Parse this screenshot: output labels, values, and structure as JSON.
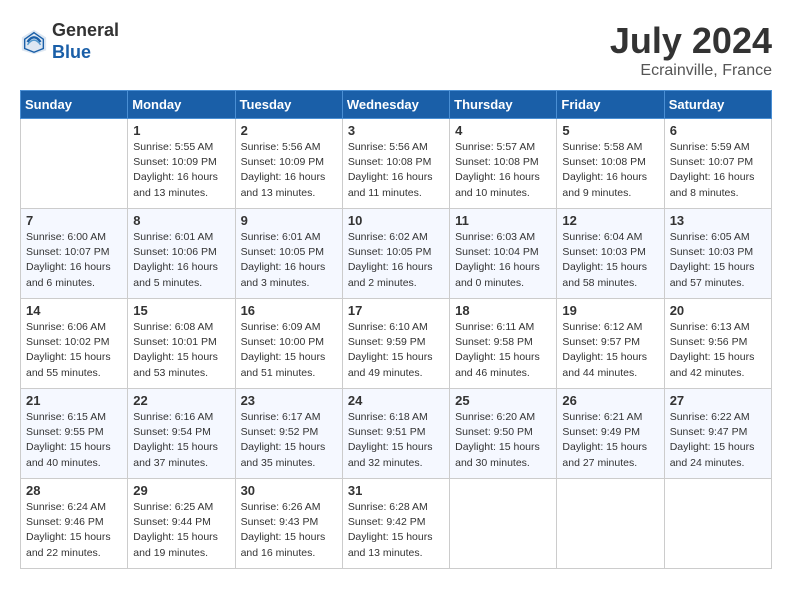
{
  "header": {
    "logo_line1": "General",
    "logo_line2": "Blue",
    "title": "July 2024",
    "location": "Ecrainville, France"
  },
  "columns": [
    "Sunday",
    "Monday",
    "Tuesday",
    "Wednesday",
    "Thursday",
    "Friday",
    "Saturday"
  ],
  "weeks": [
    [
      {
        "day": "",
        "info": ""
      },
      {
        "day": "1",
        "info": "Sunrise: 5:55 AM\nSunset: 10:09 PM\nDaylight: 16 hours\nand 13 minutes."
      },
      {
        "day": "2",
        "info": "Sunrise: 5:56 AM\nSunset: 10:09 PM\nDaylight: 16 hours\nand 13 minutes."
      },
      {
        "day": "3",
        "info": "Sunrise: 5:56 AM\nSunset: 10:08 PM\nDaylight: 16 hours\nand 11 minutes."
      },
      {
        "day": "4",
        "info": "Sunrise: 5:57 AM\nSunset: 10:08 PM\nDaylight: 16 hours\nand 10 minutes."
      },
      {
        "day": "5",
        "info": "Sunrise: 5:58 AM\nSunset: 10:08 PM\nDaylight: 16 hours\nand 9 minutes."
      },
      {
        "day": "6",
        "info": "Sunrise: 5:59 AM\nSunset: 10:07 PM\nDaylight: 16 hours\nand 8 minutes."
      }
    ],
    [
      {
        "day": "7",
        "info": "Sunrise: 6:00 AM\nSunset: 10:07 PM\nDaylight: 16 hours\nand 6 minutes."
      },
      {
        "day": "8",
        "info": "Sunrise: 6:01 AM\nSunset: 10:06 PM\nDaylight: 16 hours\nand 5 minutes."
      },
      {
        "day": "9",
        "info": "Sunrise: 6:01 AM\nSunset: 10:05 PM\nDaylight: 16 hours\nand 3 minutes."
      },
      {
        "day": "10",
        "info": "Sunrise: 6:02 AM\nSunset: 10:05 PM\nDaylight: 16 hours\nand 2 minutes."
      },
      {
        "day": "11",
        "info": "Sunrise: 6:03 AM\nSunset: 10:04 PM\nDaylight: 16 hours\nand 0 minutes."
      },
      {
        "day": "12",
        "info": "Sunrise: 6:04 AM\nSunset: 10:03 PM\nDaylight: 15 hours\nand 58 minutes."
      },
      {
        "day": "13",
        "info": "Sunrise: 6:05 AM\nSunset: 10:03 PM\nDaylight: 15 hours\nand 57 minutes."
      }
    ],
    [
      {
        "day": "14",
        "info": "Sunrise: 6:06 AM\nSunset: 10:02 PM\nDaylight: 15 hours\nand 55 minutes."
      },
      {
        "day": "15",
        "info": "Sunrise: 6:08 AM\nSunset: 10:01 PM\nDaylight: 15 hours\nand 53 minutes."
      },
      {
        "day": "16",
        "info": "Sunrise: 6:09 AM\nSunset: 10:00 PM\nDaylight: 15 hours\nand 51 minutes."
      },
      {
        "day": "17",
        "info": "Sunrise: 6:10 AM\nSunset: 9:59 PM\nDaylight: 15 hours\nand 49 minutes."
      },
      {
        "day": "18",
        "info": "Sunrise: 6:11 AM\nSunset: 9:58 PM\nDaylight: 15 hours\nand 46 minutes."
      },
      {
        "day": "19",
        "info": "Sunrise: 6:12 AM\nSunset: 9:57 PM\nDaylight: 15 hours\nand 44 minutes."
      },
      {
        "day": "20",
        "info": "Sunrise: 6:13 AM\nSunset: 9:56 PM\nDaylight: 15 hours\nand 42 minutes."
      }
    ],
    [
      {
        "day": "21",
        "info": "Sunrise: 6:15 AM\nSunset: 9:55 PM\nDaylight: 15 hours\nand 40 minutes."
      },
      {
        "day": "22",
        "info": "Sunrise: 6:16 AM\nSunset: 9:54 PM\nDaylight: 15 hours\nand 37 minutes."
      },
      {
        "day": "23",
        "info": "Sunrise: 6:17 AM\nSunset: 9:52 PM\nDaylight: 15 hours\nand 35 minutes."
      },
      {
        "day": "24",
        "info": "Sunrise: 6:18 AM\nSunset: 9:51 PM\nDaylight: 15 hours\nand 32 minutes."
      },
      {
        "day": "25",
        "info": "Sunrise: 6:20 AM\nSunset: 9:50 PM\nDaylight: 15 hours\nand 30 minutes."
      },
      {
        "day": "26",
        "info": "Sunrise: 6:21 AM\nSunset: 9:49 PM\nDaylight: 15 hours\nand 27 minutes."
      },
      {
        "day": "27",
        "info": "Sunrise: 6:22 AM\nSunset: 9:47 PM\nDaylight: 15 hours\nand 24 minutes."
      }
    ],
    [
      {
        "day": "28",
        "info": "Sunrise: 6:24 AM\nSunset: 9:46 PM\nDaylight: 15 hours\nand 22 minutes."
      },
      {
        "day": "29",
        "info": "Sunrise: 6:25 AM\nSunset: 9:44 PM\nDaylight: 15 hours\nand 19 minutes."
      },
      {
        "day": "30",
        "info": "Sunrise: 6:26 AM\nSunset: 9:43 PM\nDaylight: 15 hours\nand 16 minutes."
      },
      {
        "day": "31",
        "info": "Sunrise: 6:28 AM\nSunset: 9:42 PM\nDaylight: 15 hours\nand 13 minutes."
      },
      {
        "day": "",
        "info": ""
      },
      {
        "day": "",
        "info": ""
      },
      {
        "day": "",
        "info": ""
      }
    ]
  ]
}
